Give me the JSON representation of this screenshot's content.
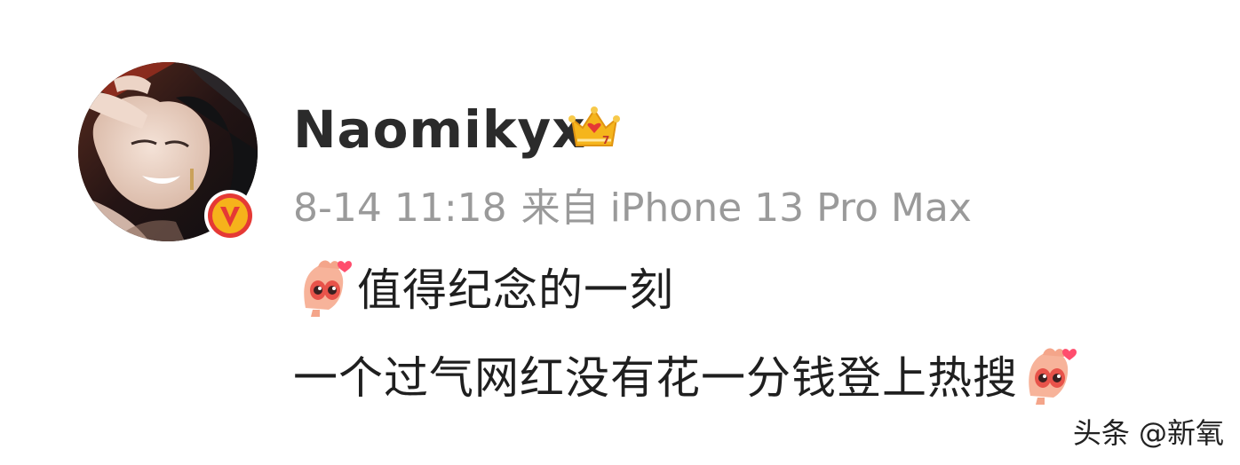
{
  "user": {
    "name": "Naomikyx",
    "crown_icon": "crown-icon",
    "verified_icon": "verified-v-icon",
    "verified_letter": "V"
  },
  "post": {
    "time": "8-14 11:18",
    "from_label": "来自",
    "device": "iPhone 13 Pro Max",
    "line1": "值得纪念的一刻",
    "line2": "一个过气网红没有花一分钱登上热搜",
    "emoji_icon": "shy-emoji-icon"
  },
  "watermark": {
    "text": "头条 @新氧"
  },
  "colors": {
    "background": "#ffffff",
    "username": "#2b2b2b",
    "meta": "#9a9a9a",
    "text": "#1f1f1f",
    "crown": "#f5b51c",
    "verified": "#f39c12"
  }
}
